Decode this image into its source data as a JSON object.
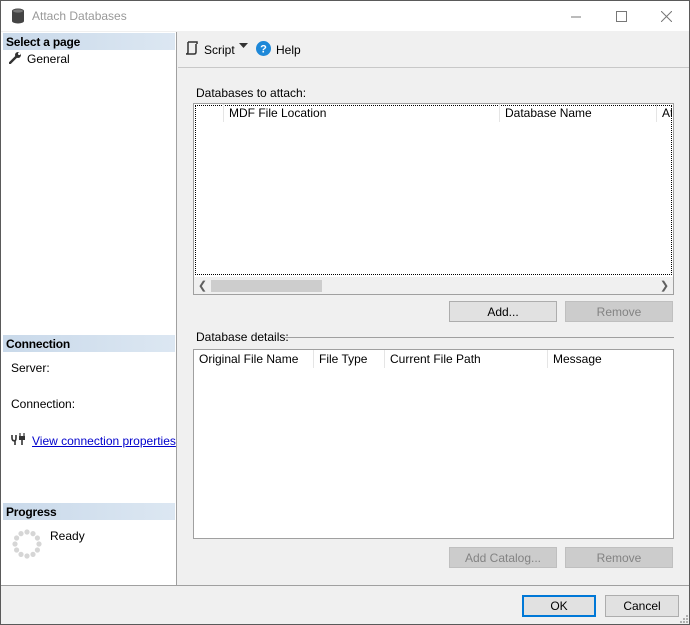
{
  "window": {
    "title": "Attach Databases",
    "controls": {
      "minimize": "minimize",
      "maximize": "maximize",
      "close": "close"
    }
  },
  "left": {
    "select_page_header": "Select a page",
    "pages": [
      {
        "label": "General",
        "icon": "wrench-icon"
      }
    ],
    "connection_header": "Connection",
    "server_label": "Server:",
    "server_value": "",
    "connection_label": "Connection:",
    "connection_value": "",
    "view_connection_properties": "View connection properties",
    "progress_header": "Progress",
    "progress_status": "Ready"
  },
  "toolbar": {
    "script_label": "Script",
    "help_label": "Help"
  },
  "attach": {
    "label": "Databases to attach:",
    "columns": [
      "",
      "MDF File Location",
      "Database Name",
      "Attach As"
    ],
    "rows": [],
    "add_button": "Add...",
    "remove_button": "Remove"
  },
  "details": {
    "label": "Database details:",
    "columns": [
      "Original File Name",
      "File Type",
      "Current File Path",
      "Message"
    ],
    "rows": [],
    "add_catalog_button": "Add Catalog...",
    "remove_button": "Remove"
  },
  "footer": {
    "ok_button": "OK",
    "cancel_button": "Cancel"
  },
  "colors": {
    "accent": "#0078d7",
    "link": "#0000cc",
    "header_gradient_start": "#c9d9ea",
    "help_icon": "#1e88d8"
  }
}
